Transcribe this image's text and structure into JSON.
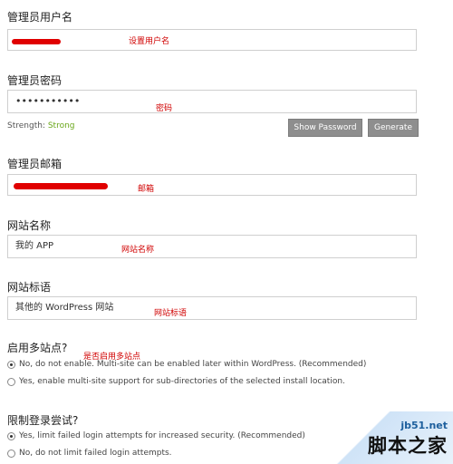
{
  "username": {
    "label": "管理员用户名",
    "annotation": "设置用户名"
  },
  "password": {
    "label": "管理员密码",
    "value": "•••••••••••",
    "annotation": "密码",
    "strength_label": "Strength:",
    "strength_value": "Strong",
    "show_button": "Show Password",
    "generate_button": "Generate"
  },
  "email": {
    "label": "管理员邮箱",
    "annotation": "邮箱"
  },
  "site_name": {
    "label": "网站名称",
    "value": "我的 APP",
    "annotation": "网站名称"
  },
  "site_tagline": {
    "label": "网站标语",
    "value": "其他的 WordPress 网站",
    "annotation": "网站标语"
  },
  "multisite": {
    "label": "启用多站点?",
    "annotation": "是否启用多站点",
    "options": [
      "No, do not enable. Multi-site can be enabled later within WordPress. (Recommended)",
      "Yes, enable multi-site support for sub-directories of the selected install location."
    ]
  },
  "login_limit": {
    "label": "限制登录尝试?",
    "options": [
      "Yes, limit failed login attempts for increased security. (Recommended)",
      "No, do not limit failed login attempts."
    ]
  },
  "watermark": {
    "site": "jb51.net",
    "name": "脚本之家"
  },
  "colors": {
    "redaction": "#e00000",
    "annotation": "#d00000",
    "strength_ok": "#6aa71a",
    "button": "#8e8e8e"
  }
}
